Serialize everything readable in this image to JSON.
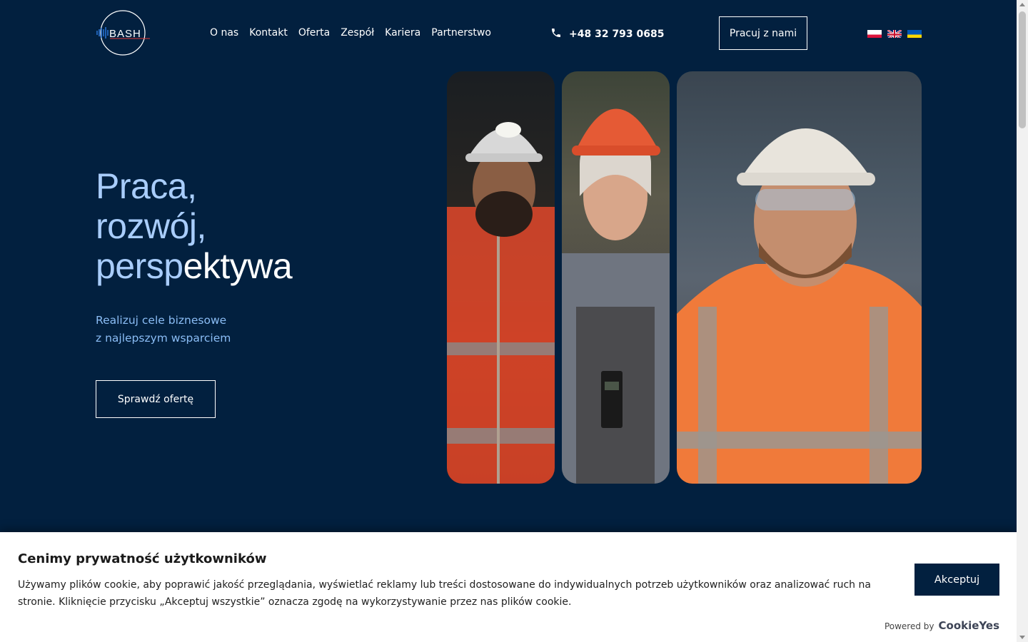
{
  "header": {
    "logo_text": "BASH",
    "nav": [
      "O nas",
      "Kontakt",
      "Oferta",
      "Zespół",
      "Kariera",
      "Partnerstwo"
    ],
    "phone": "+48 32 793 0685",
    "cta": "Pracuj z nami",
    "languages": [
      "Polski",
      "English",
      "Українська"
    ]
  },
  "hero": {
    "title_line1": "Praca,",
    "title_line2": "rozwój,",
    "title_line3_a": "persp",
    "title_line3_b": "ektywa",
    "subtitle_line1": "Realizuj cele biznesowe",
    "subtitle_line2": "z najlepszym wsparciem",
    "cta": "Sprawdź ofertę"
  },
  "cookie": {
    "title": "Cenimy prywatność użytkowników",
    "text": "Używamy plików cookie, aby poprawić jakość przeglądania, wyświetlać reklamy lub treści dostosowane do indywidualnych potrzeb użytkowników oraz analizować ruch na stronie. Kliknięcie przycisku „Akceptuj wszystkie” oznacza zgodę na wykorzystywanie przez nas plików cookie.",
    "accept": "Akceptuj",
    "powered_by": "Powered by",
    "brand": "CookieYes"
  },
  "colors": {
    "background": "#02203f",
    "accent_light_blue": "#a9cdfb",
    "subtitle_blue": "#8bbdf5"
  }
}
